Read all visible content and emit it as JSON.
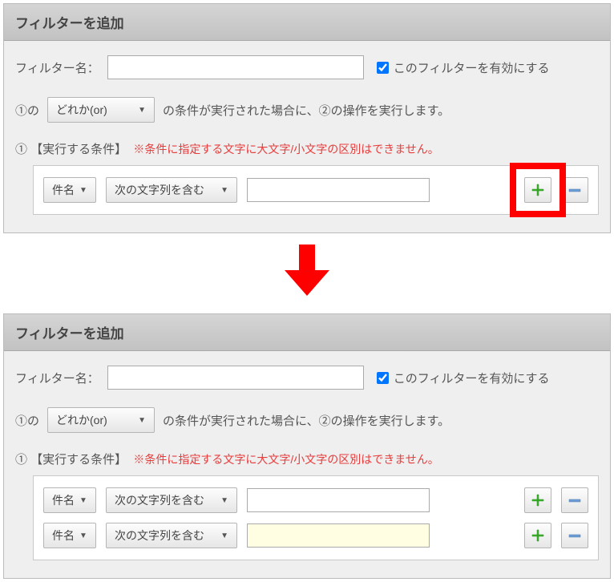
{
  "panel1": {
    "title": "フィルターを追加",
    "filter_name_label": "フィルター名：",
    "filter_name_value": "",
    "enable_label": "このフィルターを有効にする",
    "enable_checked": true,
    "rule_prefix": "①の",
    "match_mode": "どれか(or)",
    "rule_suffix": "の条件が実行された場合に、②の操作を実行します。",
    "section_label": "① 【実行する条件】",
    "section_note": "※条件に指定する文字に大文字/小文字の区別はできません。",
    "conditions": [
      {
        "field": "件名",
        "op": "次の文字列を含む",
        "value": ""
      }
    ],
    "highlight_on_add": true
  },
  "panel2": {
    "title": "フィルターを追加",
    "filter_name_label": "フィルター名：",
    "filter_name_value": "",
    "enable_label": "このフィルターを有効にする",
    "enable_checked": true,
    "rule_prefix": "①の",
    "match_mode": "どれか(or)",
    "rule_suffix": "の条件が実行された場合に、②の操作を実行します。",
    "section_label": "① 【実行する条件】",
    "section_note": "※条件に指定する文字に大文字/小文字の区別はできません。",
    "conditions": [
      {
        "field": "件名",
        "op": "次の文字列を含む",
        "value": ""
      },
      {
        "field": "件名",
        "op": "次の文字列を含む",
        "value": "",
        "empty": true
      }
    ]
  },
  "icons": {
    "plus_color": "#3CB52B",
    "minus_color": "#6C9DD6"
  }
}
